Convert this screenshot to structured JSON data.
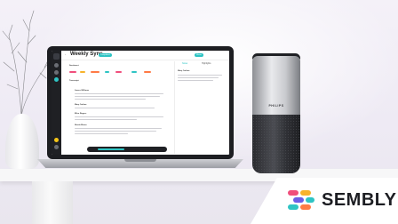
{
  "app": {
    "meeting_title": "Weekly Sync",
    "status_badge": "Completed",
    "section_sentiment": "Sentiment",
    "section_transcript": "Transcript",
    "speakers": [
      "James Williams",
      "Mary Carlton",
      "Ellen Rogers",
      "Nicola Moore"
    ],
    "right_tabs": [
      "Notes",
      "Highlights"
    ],
    "right_speaker": "Mary Carlton",
    "action_label": "Share"
  },
  "device": {
    "brand_label": "PHILIPS"
  },
  "logo": {
    "text": "SEMBLY",
    "colors": [
      "#f04e7c",
      "#f7b32b",
      "#2ec4c4",
      "#6c5ce7",
      "#ff7a45"
    ]
  },
  "colors": {
    "accent": "#2ec4c4",
    "dark": "#1f2024"
  }
}
